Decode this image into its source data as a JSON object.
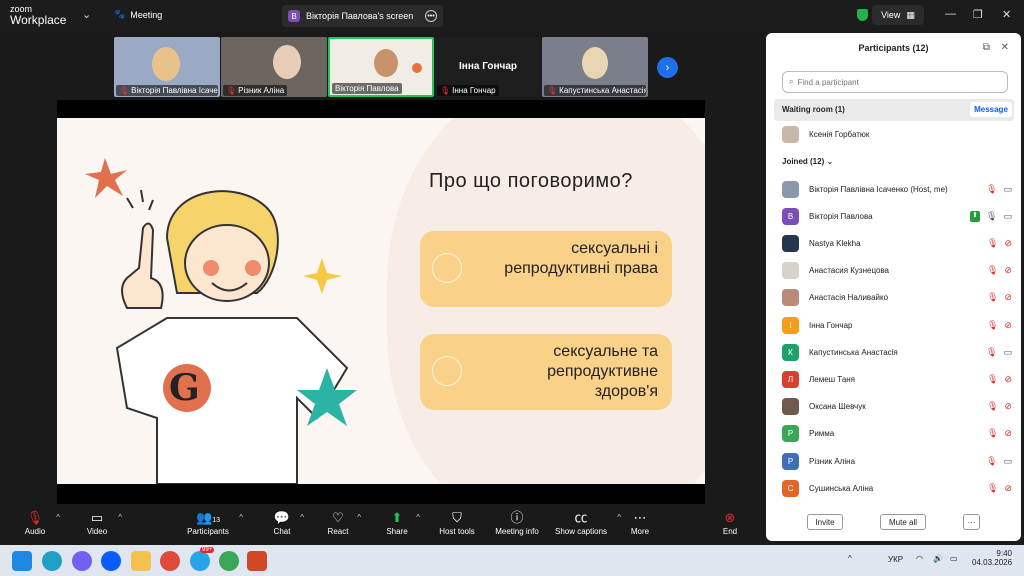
{
  "app": {
    "logo_top": "zoom",
    "logo_bottom": "Workplace",
    "meeting_label": "Meeting"
  },
  "screen_share": {
    "label": "Вікторія Павлова's screen",
    "badge": "B"
  },
  "view_button": "View",
  "filmstrip": [
    {
      "name": "Вікторія Павлівна Ісаченко",
      "color": "#9aa9c4"
    },
    {
      "name": "Різник  Аліна",
      "color": "#6d6560"
    },
    {
      "name": "Вікторія Павлова",
      "color": "#f2ece6"
    },
    {
      "name": "Інна Гончар",
      "color": "#1e1e1e",
      "big_name": "Інна Гончар"
    },
    {
      "name": "Капустинська Анастасія",
      "color": "#7b7f8b"
    }
  ],
  "slide": {
    "title": "Про що поговоримо?",
    "card1": "сексуальні і репродуктивні права",
    "card2": "сексуальне та репродуктивне здоров'я"
  },
  "participants": {
    "title": "Participants (12)",
    "search_placeholder": "Find a participant",
    "waiting_label": "Waiting room (1)",
    "message_button": "Message",
    "waiting": [
      {
        "name": "Ксенія Горбатюк",
        "avatar_color": "#c9b8a8"
      }
    ],
    "joined_label": "Joined (12)",
    "joined": [
      {
        "name": "Вікторія Павлівна Ісаченко (Host, me)",
        "avatar": "",
        "avatar_color": "#8b97ad",
        "cam": "on"
      },
      {
        "name": "Вікторія Павлова",
        "avatar": "В",
        "avatar_color": "#7b4db8",
        "cam": "on",
        "sharing": true,
        "mic_on": true
      },
      {
        "name": "Nastya Klekha",
        "avatar": "",
        "avatar_color": "#27364f",
        "cam": "off"
      },
      {
        "name": "Анастасия Кузнецова",
        "avatar": "",
        "avatar_color": "#d8d2cc",
        "cam": "off"
      },
      {
        "name": "Анастасія Наливайко",
        "avatar": "",
        "avatar_color": "#b9897a",
        "cam": "off"
      },
      {
        "name": "Інна Гончар",
        "avatar": "І",
        "avatar_color": "#f29e1c",
        "cam": "off"
      },
      {
        "name": "Капустинська Анастасія",
        "avatar": "К",
        "avatar_color": "#1f9e6e",
        "cam": "on"
      },
      {
        "name": "Лемеш Таня",
        "avatar": "Л",
        "avatar_color": "#d6402f",
        "cam": "off"
      },
      {
        "name": "Оксана Шевчук",
        "avatar": "",
        "avatar_color": "#6e5b4c",
        "cam": "off"
      },
      {
        "name": "Римма",
        "avatar": "Р",
        "avatar_color": "#3aa757",
        "cam": "off"
      },
      {
        "name": "Різник  Аліна",
        "avatar": "Р",
        "avatar_color": "#3f6fb5",
        "cam": "on"
      },
      {
        "name": "Сушинська Аліна",
        "avatar": "С",
        "avatar_color": "#e0662a",
        "cam": "off"
      }
    ],
    "invite_button": "Invite",
    "mute_all_button": "Mute all",
    "more_button": "···"
  },
  "toolbar": {
    "audio": "Audio",
    "video": "Video",
    "participants": "Participants",
    "participants_count": "13",
    "chat": "Chat",
    "react": "React",
    "share": "Share",
    "host_tools": "Host tools",
    "meeting_info": "Meeting info",
    "show_captions": "Show captions",
    "more": "More",
    "end": "End"
  },
  "taskbar": {
    "lang": "УКР",
    "time": "9:40",
    "date": "04.03.2026",
    "badge": "99+"
  }
}
